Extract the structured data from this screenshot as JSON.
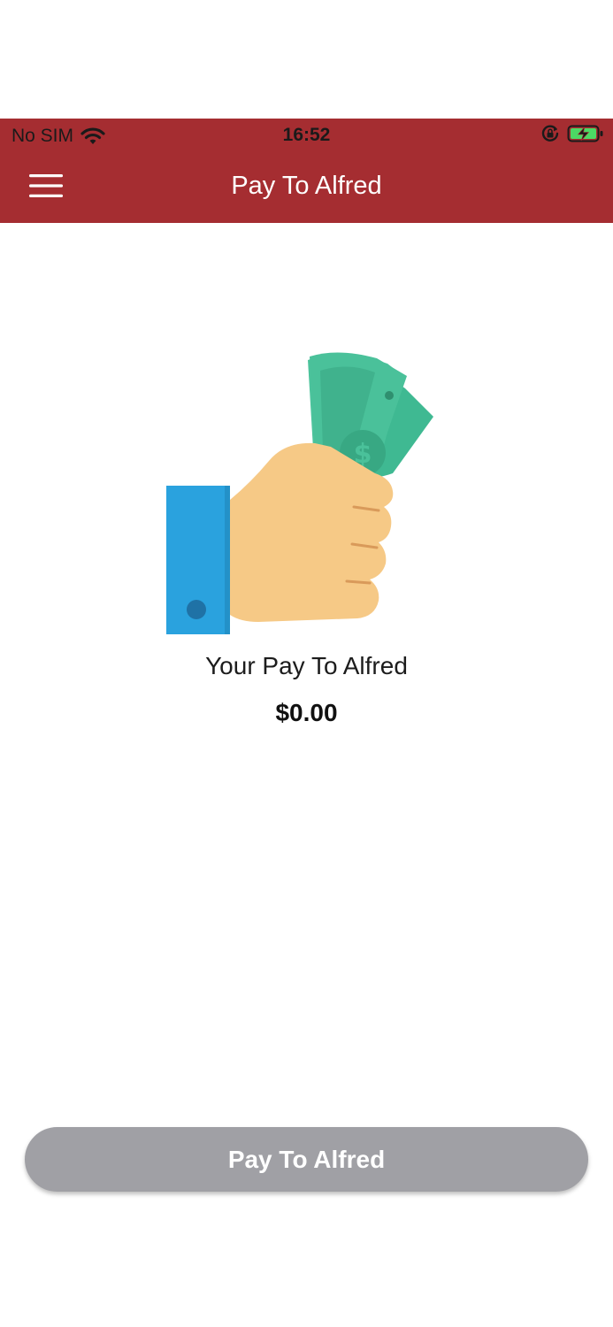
{
  "status_bar": {
    "carrier": "No SIM",
    "time": "16:52",
    "wifi_icon": "wifi-icon",
    "rotation_lock_icon": "rotation-lock-icon",
    "battery_icon": "battery-charging-icon"
  },
  "header": {
    "title": "Pay To Alfred",
    "menu_icon": "hamburger-menu-icon",
    "background_color": "#a52d31"
  },
  "main": {
    "illustration_icon": "hand-holding-money-icon",
    "label": "Your Pay To Alfred",
    "amount": "$0.00"
  },
  "footer": {
    "button_label": "Pay To Alfred",
    "button_color": "#a0a0a5"
  }
}
